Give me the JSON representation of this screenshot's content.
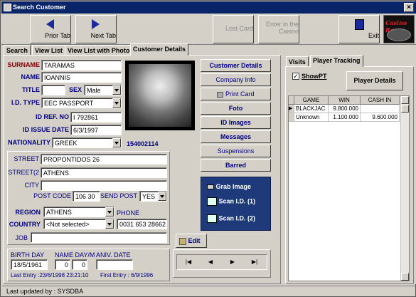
{
  "window": {
    "title": "Search Customer",
    "close_glyph": "×"
  },
  "toolbar": {
    "prior_tab": "Prior Tab",
    "next_tab": "Next Tab",
    "lost_card": "Lost Card",
    "enter_casino_line1": "Enter in the",
    "enter_casino_line2": "Casino",
    "exit": "Exit",
    "logo_text": "Casino Ro"
  },
  "tabs": [
    "Search",
    "View List",
    "View List with Photos",
    "Customer Details"
  ],
  "right_tabs": [
    "Visits",
    "Player Tracking"
  ],
  "fields": {
    "surname_label": "SURNAME",
    "surname": "TARAMAS",
    "name_label": "NAME",
    "name": "IOANNIS",
    "title_label": "TITLE",
    "title": "",
    "sex_label": "SEX",
    "sex": "Male",
    "id_type_label": "I.D. TYPE",
    "id_type": "EEC PASSPORT",
    "id_ref_label": "ID REF. NO",
    "id_ref": "I 792861",
    "id_issue_label": "ID ISSUE DATE",
    "id_issue": "6/3/1997",
    "nationality_label": "NATIONALITY",
    "nationality": "GREEK",
    "card_number": "154002114",
    "street_label": "STREET",
    "street": "PROPONTIDOS  26",
    "street2_label": "STREET(2",
    "street2": "ATHENS",
    "city_label": "CITY",
    "city": "",
    "post_code_label": "POST CODE",
    "post_code": "106 30",
    "send_post_label": "SEND POST",
    "send_post": "YES",
    "region_label": "REGION",
    "region": "ATHENS",
    "phone_label": "PHONE",
    "phone": "0031 653 28662",
    "country_label": "COUNTRY",
    "country": "<Not selected>",
    "job_label": "JOB",
    "job": "",
    "birth_day_label": "BIRTH DAY",
    "birth_day": "18/5/1961",
    "name_day_label": "NAME DAY/M",
    "name_day_d": "0",
    "name_day_m": "0",
    "aniv_date_label": "ANIV. DATE",
    "aniv_date": "",
    "last_entry": "Last Entry :23/6/1998 23:21:10",
    "first_entry": "First Entry :  6/9/1996"
  },
  "actions": {
    "customer_details": "Customer Details",
    "company_info": "Company Info",
    "print_card": "Print Card",
    "foto": "Foto",
    "id_images": "ID Images",
    "messages": "Messages",
    "suspensions": "Suspensions",
    "barred": "Barred",
    "grab_image": "Grab Image",
    "scan_id_1": "Scan I.D. (1)",
    "scan_id_2": "Scan I.D. (2)",
    "edit": "Edit"
  },
  "navigator": {
    "first": "|◀",
    "prev": "◀",
    "next": "▶",
    "last": "▶|"
  },
  "player_tracking": {
    "show_pt": "ShowPT",
    "player_details": "Player Details",
    "columns": [
      "GAME",
      "WIN",
      "CASH IN"
    ],
    "rows": [
      {
        "game": "BLACKJAC",
        "win": "9.800.000",
        "cash_in": ""
      },
      {
        "game": "Unknown",
        "win": "1.100.000",
        "cash_in": "9.600.000"
      }
    ]
  },
  "status": {
    "last_updated": "Last updated by :  SYSDBA"
  },
  "colors": {
    "title_bar": "#0a246a",
    "label_red": "#800000",
    "label_navy": "#000080",
    "scan_panel": "#1f3a7a",
    "window_bg": "#d4d0c8"
  }
}
